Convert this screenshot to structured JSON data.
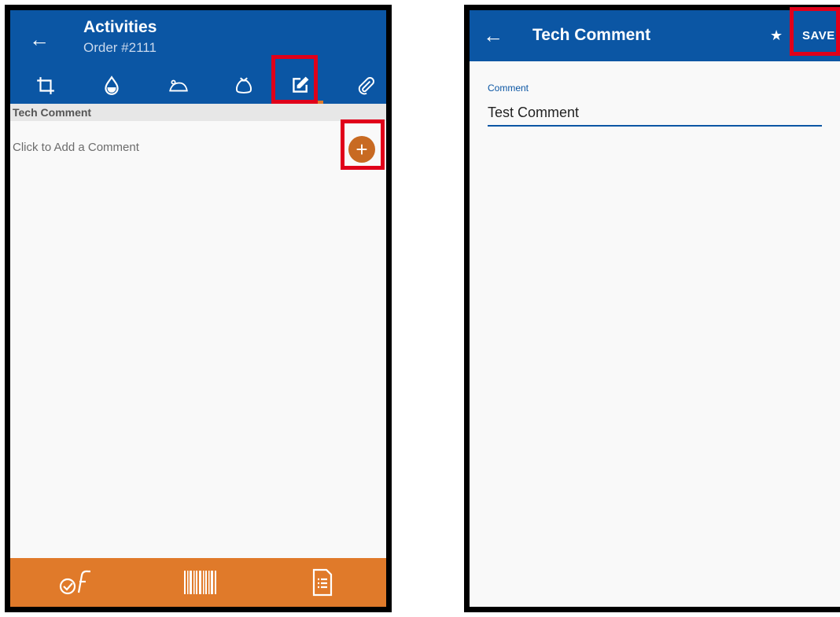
{
  "left_screen": {
    "header": {
      "title": "Activities",
      "subtitle": "Order #2111",
      "back_icon": "arrow-left-icon",
      "background_color": "#0b56a4"
    },
    "tabs": [
      {
        "icon": "crop-icon",
        "active": false
      },
      {
        "icon": "water-drop-icon",
        "active": false
      },
      {
        "icon": "rodent-icon",
        "active": false
      },
      {
        "icon": "sack-icon",
        "active": false
      },
      {
        "icon": "edit-note-icon",
        "active": true
      },
      {
        "icon": "paperclip-icon",
        "active": false
      }
    ],
    "section_header": "Tech Comment",
    "empty_hint": "Click to Add a Comment",
    "add_button_icon": "plus-icon",
    "add_button_color": "#c86a22",
    "bottom_bar": {
      "background_color": "#e07a2a",
      "items": [
        {
          "icon": "check-wrench-icon"
        },
        {
          "icon": "barcode-icon"
        },
        {
          "icon": "document-icon"
        }
      ]
    }
  },
  "right_screen": {
    "header": {
      "title": "Tech Comment",
      "back_icon": "arrow-left-icon",
      "favorite_icon": "star-icon",
      "save_label": "SAVE"
    },
    "comment_field": {
      "label": "Comment",
      "value": "Test Comment"
    }
  },
  "highlight_color": "#e0001a"
}
